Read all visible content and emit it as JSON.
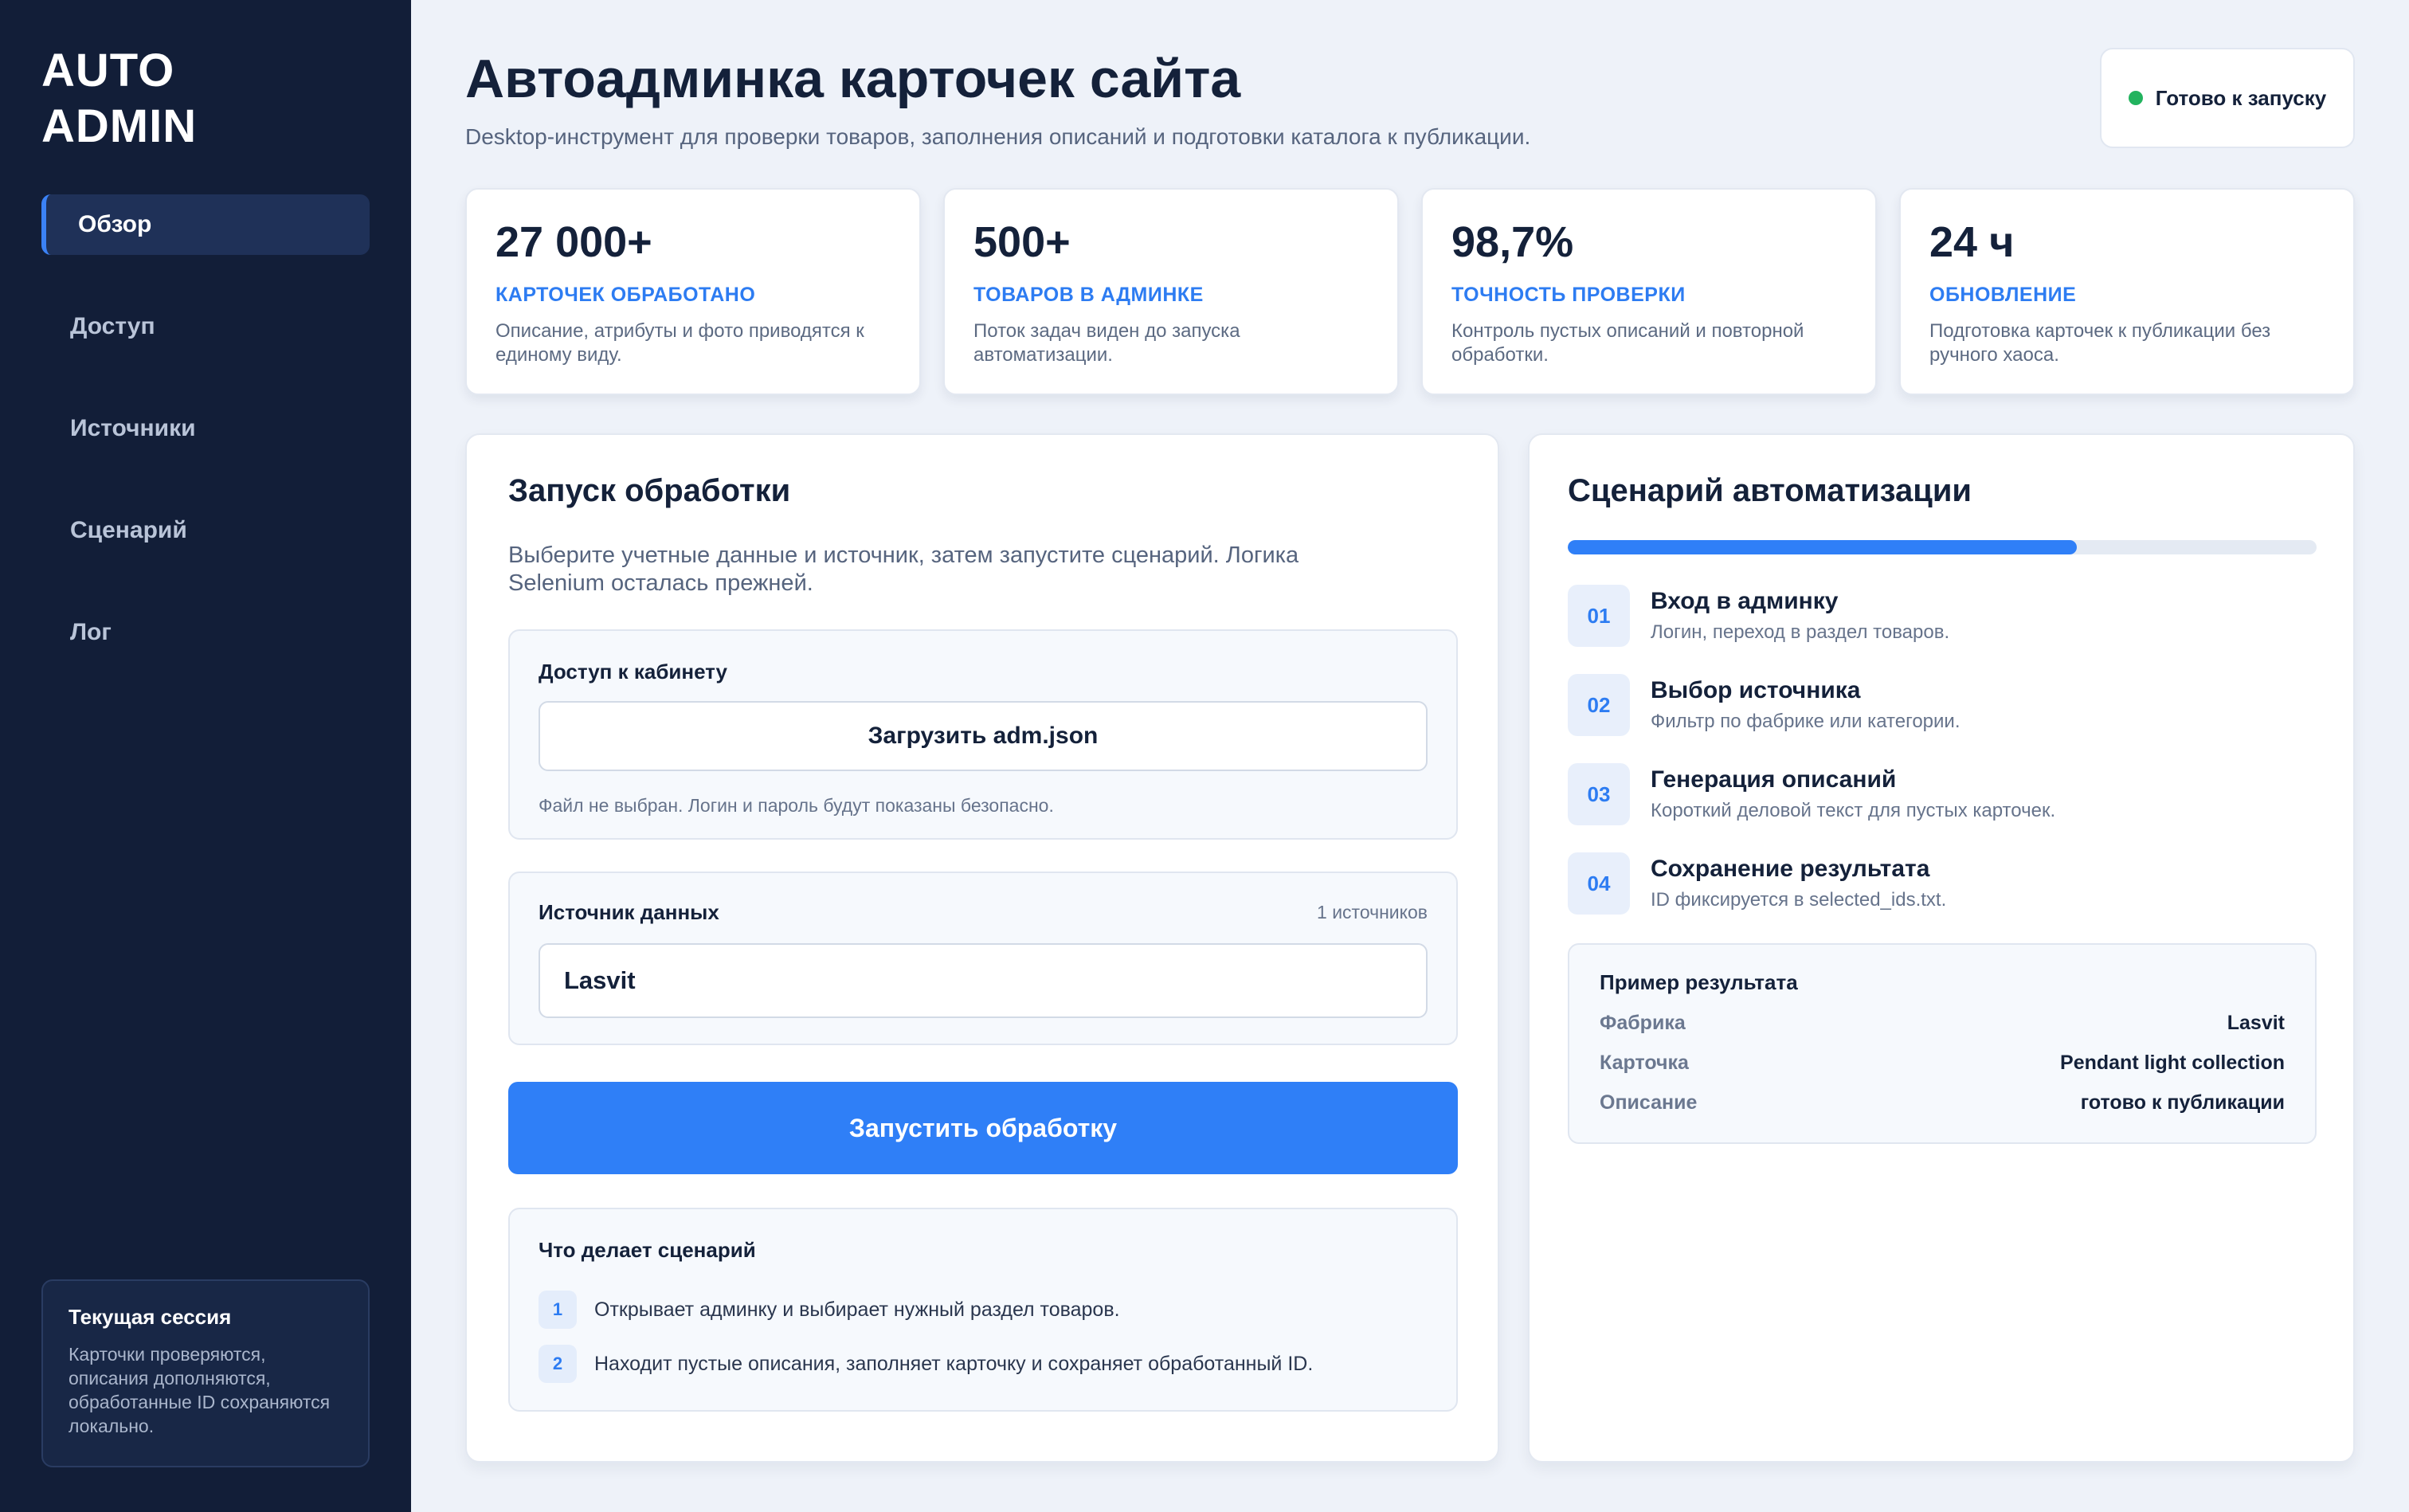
{
  "sidebar": {
    "logo_line1": "AUTO",
    "logo_line2": "ADMIN",
    "items": [
      {
        "label": "Обзор",
        "active": true
      },
      {
        "label": "Доступ"
      },
      {
        "label": "Источники"
      },
      {
        "label": "Сценарий"
      },
      {
        "label": "Лог"
      }
    ],
    "session": {
      "title": "Текущая сессия",
      "text": "Карточки проверяются, описания дополняются, обработанные ID сохраняются локально."
    }
  },
  "header": {
    "title": "Автоадминка карточек сайта",
    "subtitle": "Desktop-инструмент для проверки товаров, заполнения описаний и подготовки каталога к публикации.",
    "status": "Готово к запуску",
    "status_color": "#22b35e"
  },
  "stats": [
    {
      "value": "27 000+",
      "label": "КАРТОЧЕК ОБРАБОТАНО",
      "desc": "Описание, атрибуты и фото приводятся к единому виду."
    },
    {
      "value": "500+",
      "label": "ТОВАРОВ В АДМИНКЕ",
      "desc": "Поток задач виден до запуска автоматизации."
    },
    {
      "value": "98,7%",
      "label": "ТОЧНОСТЬ ПРОВЕРКИ",
      "desc": "Контроль пустых описаний и повторной обработки."
    },
    {
      "value": "24 ч",
      "label": "ОБНОВЛЕНИЕ",
      "desc": "Подготовка карточек к публикации без ручного хаоса."
    }
  ],
  "launch": {
    "title": "Запуск обработки",
    "desc": "Выберите учетные данные и источник, затем запустите сценарий. Логика Selenium осталась прежней.",
    "access": {
      "label": "Доступ к кабинету",
      "button": "Загрузить adm.json",
      "hint": "Файл не выбран. Логин и пароль будут показаны безопасно."
    },
    "source": {
      "label": "Источник данных",
      "count": "1 источников",
      "value": "Lasvit"
    },
    "run_button": "Запустить обработку",
    "what": {
      "title": "Что делает сценарий",
      "steps": [
        {
          "num": "1",
          "text": "Открывает админку и выбирает нужный раздел товаров."
        },
        {
          "num": "2",
          "text": "Находит пустые описания, заполняет карточку и сохраняет обработанный ID."
        }
      ]
    }
  },
  "scenario": {
    "title": "Сценарий автоматизации",
    "progress": 0.68,
    "accent": "#2f7ff7",
    "steps": [
      {
        "num": "01",
        "title": "Вход в админку",
        "desc": "Логин, переход в раздел товаров."
      },
      {
        "num": "02",
        "title": "Выбор источника",
        "desc": "Фильтр по фабрике или категории."
      },
      {
        "num": "03",
        "title": "Генерация описаний",
        "desc": "Короткий деловой текст для пустых карточек."
      },
      {
        "num": "04",
        "title": "Сохранение результата",
        "desc": "ID фиксируется в selected_ids.txt."
      }
    ],
    "example": {
      "title": "Пример результата",
      "rows": [
        {
          "key": "Фабрика",
          "value": "Lasvit"
        },
        {
          "key": "Карточка",
          "value": "Pendant light collection"
        },
        {
          "key": "Описание",
          "value": "готово к публикации"
        }
      ]
    }
  }
}
